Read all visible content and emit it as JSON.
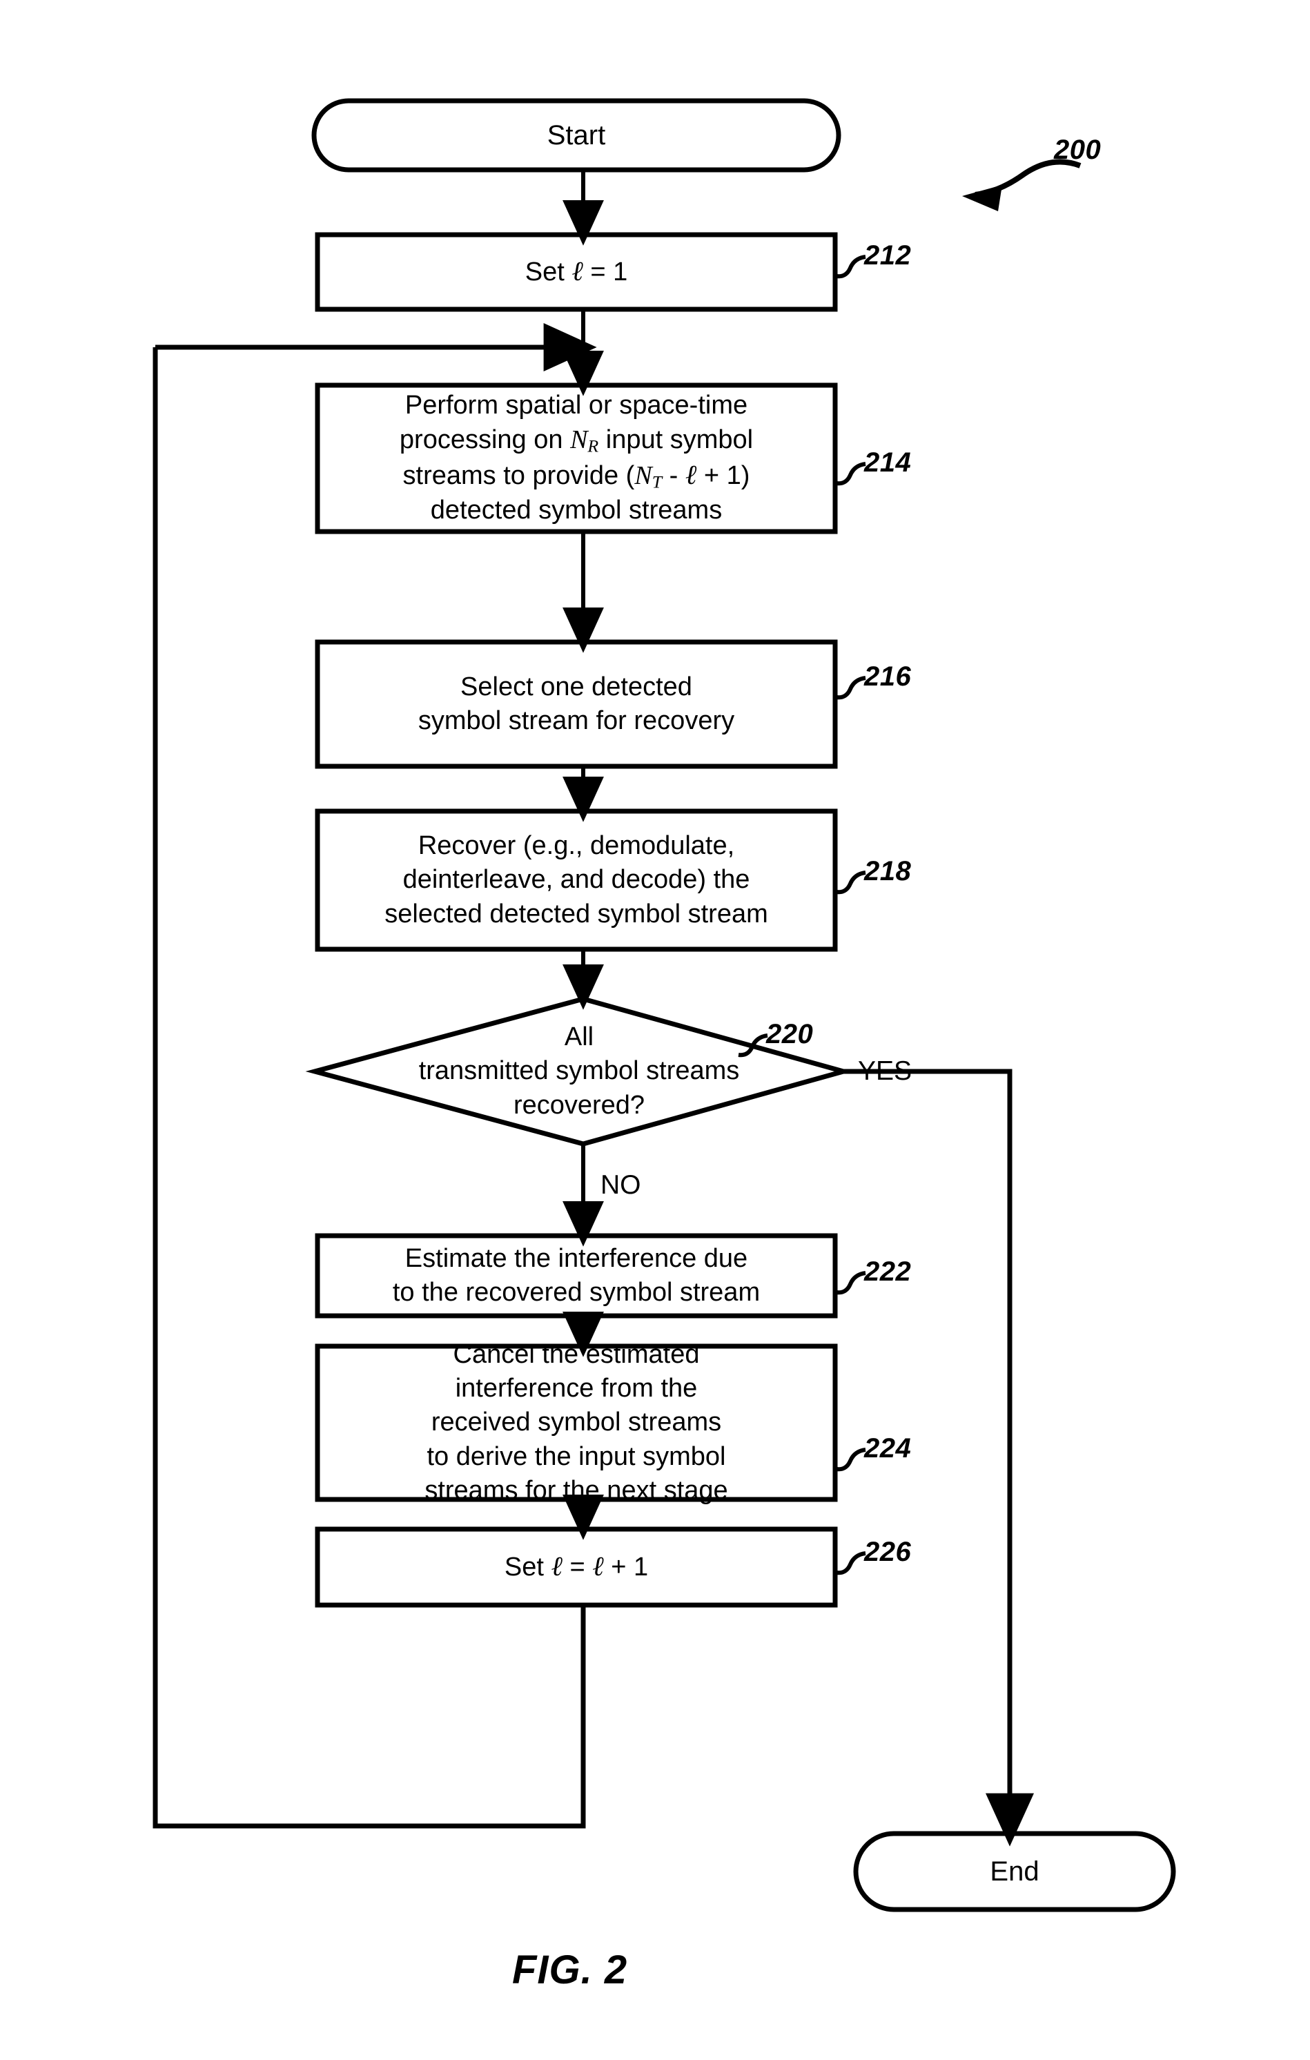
{
  "figure": {
    "caption": "FIG. 2",
    "diagram_reference": "200",
    "type": "flowchart"
  },
  "nodes": [
    {
      "id": "start",
      "shape": "terminal",
      "ref": "",
      "lines": [
        "Start"
      ]
    },
    {
      "id": "step212",
      "shape": "process",
      "ref": "212",
      "lines": [
        "Set ℓ = 1"
      ]
    },
    {
      "id": "step214",
      "shape": "process",
      "ref": "214",
      "lines": [
        "Perform spatial or space-time",
        "processing on N_R input symbol",
        "streams to provide (N_T - ℓ + 1)",
        "detected symbol streams"
      ]
    },
    {
      "id": "step216",
      "shape": "process",
      "ref": "216",
      "lines": [
        "Select one detected",
        "symbol stream for recovery"
      ]
    },
    {
      "id": "step218",
      "shape": "process",
      "ref": "218",
      "lines": [
        "Recover (e.g., demodulate,",
        "deinterleave, and decode) the",
        "selected detected symbol stream"
      ]
    },
    {
      "id": "decision220",
      "shape": "decision",
      "ref": "220",
      "lines": [
        "All",
        "transmitted symbol streams",
        "recovered?"
      ]
    },
    {
      "id": "step222",
      "shape": "process",
      "ref": "222",
      "lines": [
        "Estimate the interference due",
        "to the recovered symbol stream"
      ]
    },
    {
      "id": "step224",
      "shape": "process",
      "ref": "224",
      "lines": [
        "Cancel the estimated",
        "interference from the",
        "received symbol streams",
        "to derive the input symbol",
        "streams for the next stage"
      ]
    },
    {
      "id": "step226",
      "shape": "process",
      "ref": "226",
      "lines": [
        "Set ℓ = ℓ + 1"
      ]
    },
    {
      "id": "end",
      "shape": "terminal",
      "ref": "",
      "lines": [
        "End"
      ]
    }
  ],
  "branch_labels": {
    "yes": "YES",
    "no": "NO"
  },
  "node_text": {
    "start": "Start",
    "end": "End",
    "step212_line1": "Set ",
    "step212_l": "ℓ",
    "step212_rest": " = 1",
    "step214_line1": "Perform spatial or space-time",
    "step214_line2_a": "processing on ",
    "step214_line2_nr": "N",
    "step214_line2_nr_sub": "R",
    "step214_line2_b": " input symbol",
    "step214_line3_a": "streams to provide (",
    "step214_line3_nt": "N",
    "step214_line3_nt_sub": "T",
    "step214_line3_b": " - ",
    "step214_line3_l": "ℓ",
    "step214_line3_c": " + 1)",
    "step214_line4": "detected symbol streams",
    "step216_line1": "Select one detected",
    "step216_line2": "symbol stream for recovery",
    "step218_line1": "Recover (e.g., demodulate,",
    "step218_line2": "deinterleave, and decode) the",
    "step218_line3": "selected detected symbol stream",
    "decision220_line1": "All",
    "decision220_line2": "transmitted symbol streams",
    "decision220_line3": "recovered?",
    "step222_line1": "Estimate the interference due",
    "step222_line2": "to the recovered symbol stream",
    "step224_line1": "Cancel the estimated",
    "step224_line2": "interference from the",
    "step224_line3": "received symbol streams",
    "step224_line4": "to derive the input symbol",
    "step224_line5": "streams for the next stage",
    "step226_a": "Set ",
    "step226_l1": "ℓ",
    "step226_eq": " = ",
    "step226_l2": "ℓ",
    "step226_plus": " + 1"
  },
  "refs": {
    "diagram": "200",
    "r212": "212",
    "r214": "214",
    "r216": "216",
    "r218": "218",
    "r220": "220",
    "r222": "222",
    "r224": "224",
    "r226": "226"
  },
  "colors": {
    "stroke": "#000000",
    "background": "#ffffff",
    "text": "#000000"
  }
}
